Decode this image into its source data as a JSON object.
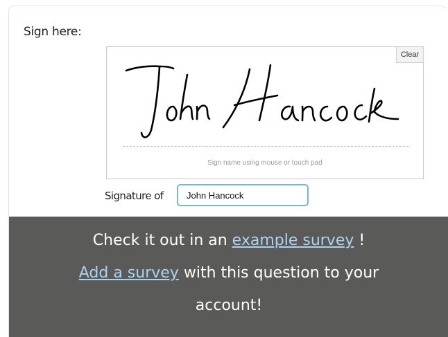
{
  "question": {
    "label": "Sign here:"
  },
  "signature_pad": {
    "signed_name": "John Hancock",
    "clear_label": "Clear",
    "hint": "Sign name using mouse or touch pad"
  },
  "signature_of": {
    "label": "Signature of",
    "value": "John Hancock"
  },
  "promo": {
    "line1_prefix": "Check it out in an ",
    "example_link": "example survey",
    "line1_suffix": " !",
    "add_link": "Add a survey",
    "line2_suffix": " with this question to your",
    "line3": "account!",
    "background_color": "#5a5a58",
    "link_color": "#a9d4ef"
  }
}
